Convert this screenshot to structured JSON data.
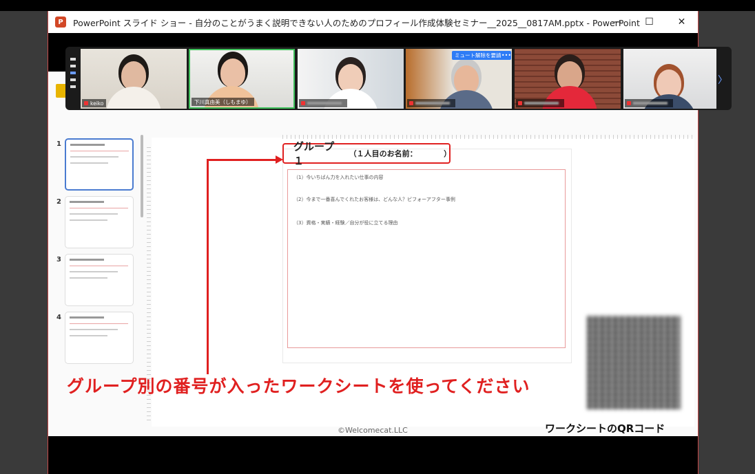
{
  "window": {
    "title": "PowerPoint スライド ショー  -  自分のことがうまく説明できない人のためのプロフィール作成体験セミナー__2025__0817AM.pptx - PowerPoint",
    "app_icon": "P",
    "controls": {
      "minimize": "—",
      "maximize": "☐",
      "close": "✕"
    }
  },
  "video_strip": {
    "participants": [
      {
        "name": "keiko",
        "muted": true,
        "speaking": false
      },
      {
        "name": "下川真由美（しもまゆ）",
        "muted": false,
        "speaking": true
      },
      {
        "name": "",
        "muted": true,
        "speaking": false
      },
      {
        "name": "",
        "muted": true,
        "speaking": false
      },
      {
        "name": "",
        "muted": true,
        "speaking": false
      },
      {
        "name": "",
        "muted": true,
        "speaking": false
      }
    ],
    "unmute_request_label": "ミュート解除を要請",
    "more_label": "•••",
    "next_label": "〉"
  },
  "thumbnails": {
    "numbers": [
      "1",
      "2",
      "3",
      "4"
    ]
  },
  "slide": {
    "group_title": "グループ１",
    "group_subtitle": "（１人目のお名前：　　　　）",
    "questions": [
      "（1）今いちばん力を入れたい仕事の内容",
      "（2）今まで一番喜んでくれたお客様は、どんな人？ビフォーアフター事例",
      "（3）資格・実績・経験／自分が役に立てる理由"
    ],
    "caption": "グループ別の番号が入ったワークシートを使ってください",
    "qr_label": "ワークシートのQRコード",
    "copyright": "©Welcomecat.LLC"
  },
  "colors": {
    "accent_red": "#e02020",
    "zoom_blue": "#2e7cf6",
    "speaking_green": "#3ec05a"
  }
}
